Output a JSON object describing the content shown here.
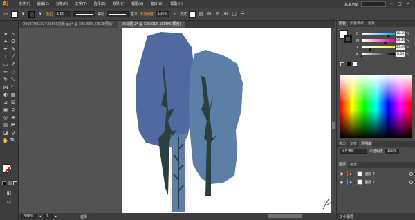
{
  "app": {
    "logo": "Ai",
    "brand_color": "#f7931e"
  },
  "menubar": {
    "items": [
      "文件(F)",
      "编辑(E)",
      "对象(O)",
      "文字(T)",
      "选择(S)",
      "效果(C)",
      "视图(V)",
      "窗口(W)",
      "帮助(H)"
    ],
    "workspace": "基本功能",
    "window_controls": [
      "–",
      "□",
      "×"
    ]
  },
  "controlbar": {
    "fill_color": "#ffffff",
    "stroke_color": "#222222",
    "stroke_label": "描边",
    "stroke_weight": "1 pt",
    "profile_label": "等比",
    "brush_label": "基本",
    "opacity_label": "不透明度",
    "opacity_value": "100%",
    "style_label": "样式"
  },
  "tabs": [
    {
      "label": "2008708122436865前景.jpg* @ 386.65% (RGB/预览)",
      "active": false
    },
    {
      "label": "未标题-2* @ 336.01% (CMYK/预览)",
      "active": true
    }
  ],
  "artwork": {
    "tree_left_color": "#5069a0",
    "tree_right_color": "#5b7fa6",
    "trunk_color": "#29403f"
  },
  "statusbar": {
    "zoom": "336%",
    "page": "1",
    "tool_name": "选择"
  },
  "color_panel": {
    "tabs": [
      "颜色",
      "颜色参考",
      "色板"
    ],
    "rows": [
      {
        "label": "C",
        "value": "78.39",
        "knob_pct": 0.78
      },
      {
        "label": "M",
        "value": "68.24",
        "knob_pct": 0.68
      },
      {
        "label": "Y",
        "value": "25.49",
        "knob_pct": 0.25
      },
      {
        "label": "K",
        "value": "0.00",
        "knob_pct": 0.0
      }
    ],
    "percent": "%"
  },
  "mid_panel": {
    "tabs": [
      "描边",
      "渐变",
      "透明度"
    ],
    "field_a": "正片叠底",
    "field_b": "不透明度",
    "field_b_value": "100%"
  },
  "layers_panel": {
    "tabs": [
      "图层",
      "画板"
    ],
    "layers": [
      {
        "name": "图层 2",
        "color": "#e6422e"
      },
      {
        "name": "图层 1",
        "color": "#4a7ef0"
      }
    ],
    "footer": "2 个图层"
  }
}
